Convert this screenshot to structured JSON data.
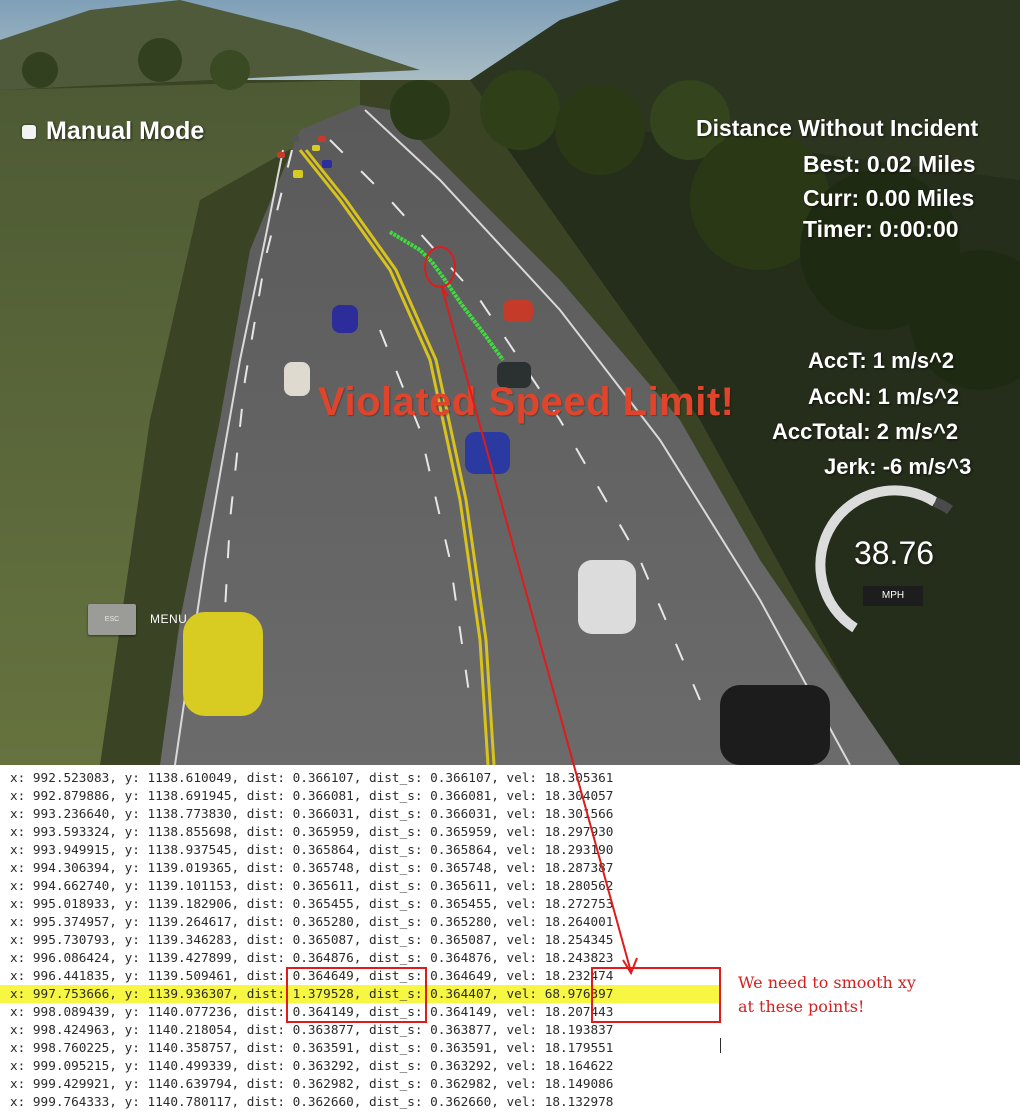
{
  "hud": {
    "mode_label": "Manual Mode",
    "distance_title": "Distance Without Incident",
    "best": "Best: 0.02 Miles",
    "curr": "Curr: 0.00 Miles",
    "timer": "Timer: 0:00:00",
    "acc_t": "AccT: 1 m/s^2",
    "acc_n": "AccN: 1 m/s^2",
    "acc_total": "AccTotal: 2 m/s^2",
    "jerk": "Jerk: -6 m/s^3",
    "warning": "Violated Speed Limit!",
    "speed_value": "38.76",
    "speed_unit": "MPH",
    "esc_label": "ESC",
    "menu_label": "MENU"
  },
  "annotation": {
    "note": "We need to smooth xy at these points!",
    "annotation_color": "#e01b1b"
  },
  "colors": {
    "highlight": "#f7f743",
    "warning": "#e0442a",
    "trajectory": "#3fdc3f"
  },
  "log_lines": [
    "x: 992.523083, y: 1138.610049, dist: 0.366107, dist_s: 0.366107, vel: 18.305361",
    "x: 992.879886, y: 1138.691945, dist: 0.366081, dist_s: 0.366081, vel: 18.304057",
    "x: 993.236640, y: 1138.773830, dist: 0.366031, dist_s: 0.366031, vel: 18.301566",
    "x: 993.593324, y: 1138.855698, dist: 0.365959, dist_s: 0.365959, vel: 18.297930",
    "x: 993.949915, y: 1138.937545, dist: 0.365864, dist_s: 0.365864, vel: 18.293190",
    "x: 994.306394, y: 1139.019365, dist: 0.365748, dist_s: 0.365748, vel: 18.287387",
    "x: 994.662740, y: 1139.101153, dist: 0.365611, dist_s: 0.365611, vel: 18.280562",
    "x: 995.018933, y: 1139.182906, dist: 0.365455, dist_s: 0.365455, vel: 18.272753",
    "x: 995.374957, y: 1139.264617, dist: 0.365280, dist_s: 0.365280, vel: 18.264001",
    "x: 995.730793, y: 1139.346283, dist: 0.365087, dist_s: 0.365087, vel: 18.254345",
    "x: 996.086424, y: 1139.427899, dist: 0.364876, dist_s: 0.364876, vel: 18.243823",
    "x: 996.441835, y: 1139.509461, dist: 0.364649, dist_s: 0.364649, vel: 18.232474",
    "x: 997.753666, y: 1139.936307, dist: 1.379528, dist_s: 0.364407, vel: 68.976397",
    "x: 998.089439, y: 1140.077236, dist: 0.364149, dist_s: 0.364149, vel: 18.207443",
    "x: 998.424963, y: 1140.218054, dist: 0.363877, dist_s: 0.363877, vel: 18.193837",
    "x: 998.760225, y: 1140.358757, dist: 0.363591, dist_s: 0.363591, vel: 18.179551",
    "x: 999.095215, y: 1140.499339, dist: 0.363292, dist_s: 0.363292, vel: 18.164622",
    "x: 999.429921, y: 1140.639794, dist: 0.362982, dist_s: 0.362982, vel: 18.149086",
    "x: 999.764333, y: 1140.780117, dist: 0.362660, dist_s: 0.362660, vel: 18.132978"
  ]
}
